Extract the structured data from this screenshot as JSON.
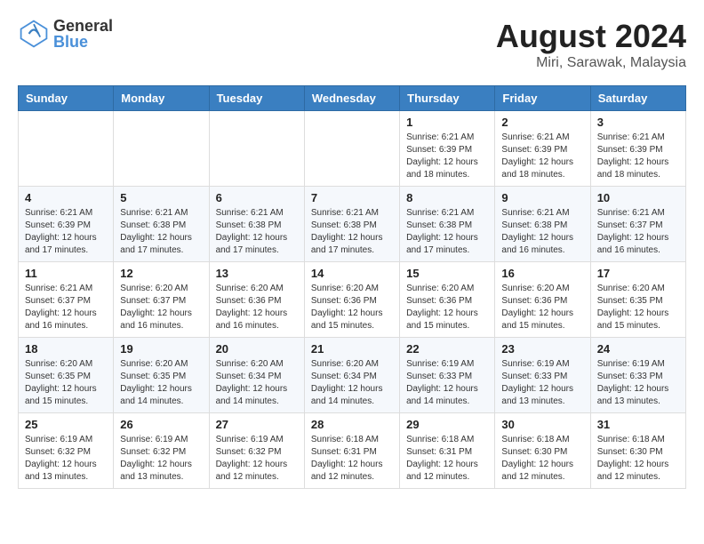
{
  "logo": {
    "line1": "General",
    "line2": "Blue"
  },
  "title": "August 2024",
  "subtitle": "Miri, Sarawak, Malaysia",
  "days_of_week": [
    "Sunday",
    "Monday",
    "Tuesday",
    "Wednesday",
    "Thursday",
    "Friday",
    "Saturday"
  ],
  "weeks": [
    [
      {
        "day": "",
        "info": ""
      },
      {
        "day": "",
        "info": ""
      },
      {
        "day": "",
        "info": ""
      },
      {
        "day": "",
        "info": ""
      },
      {
        "day": "1",
        "info": "Sunrise: 6:21 AM\nSunset: 6:39 PM\nDaylight: 12 hours\nand 18 minutes."
      },
      {
        "day": "2",
        "info": "Sunrise: 6:21 AM\nSunset: 6:39 PM\nDaylight: 12 hours\nand 18 minutes."
      },
      {
        "day": "3",
        "info": "Sunrise: 6:21 AM\nSunset: 6:39 PM\nDaylight: 12 hours\nand 18 minutes."
      }
    ],
    [
      {
        "day": "4",
        "info": "Sunrise: 6:21 AM\nSunset: 6:39 PM\nDaylight: 12 hours\nand 17 minutes."
      },
      {
        "day": "5",
        "info": "Sunrise: 6:21 AM\nSunset: 6:38 PM\nDaylight: 12 hours\nand 17 minutes."
      },
      {
        "day": "6",
        "info": "Sunrise: 6:21 AM\nSunset: 6:38 PM\nDaylight: 12 hours\nand 17 minutes."
      },
      {
        "day": "7",
        "info": "Sunrise: 6:21 AM\nSunset: 6:38 PM\nDaylight: 12 hours\nand 17 minutes."
      },
      {
        "day": "8",
        "info": "Sunrise: 6:21 AM\nSunset: 6:38 PM\nDaylight: 12 hours\nand 17 minutes."
      },
      {
        "day": "9",
        "info": "Sunrise: 6:21 AM\nSunset: 6:38 PM\nDaylight: 12 hours\nand 16 minutes."
      },
      {
        "day": "10",
        "info": "Sunrise: 6:21 AM\nSunset: 6:37 PM\nDaylight: 12 hours\nand 16 minutes."
      }
    ],
    [
      {
        "day": "11",
        "info": "Sunrise: 6:21 AM\nSunset: 6:37 PM\nDaylight: 12 hours\nand 16 minutes."
      },
      {
        "day": "12",
        "info": "Sunrise: 6:20 AM\nSunset: 6:37 PM\nDaylight: 12 hours\nand 16 minutes."
      },
      {
        "day": "13",
        "info": "Sunrise: 6:20 AM\nSunset: 6:36 PM\nDaylight: 12 hours\nand 16 minutes."
      },
      {
        "day": "14",
        "info": "Sunrise: 6:20 AM\nSunset: 6:36 PM\nDaylight: 12 hours\nand 15 minutes."
      },
      {
        "day": "15",
        "info": "Sunrise: 6:20 AM\nSunset: 6:36 PM\nDaylight: 12 hours\nand 15 minutes."
      },
      {
        "day": "16",
        "info": "Sunrise: 6:20 AM\nSunset: 6:36 PM\nDaylight: 12 hours\nand 15 minutes."
      },
      {
        "day": "17",
        "info": "Sunrise: 6:20 AM\nSunset: 6:35 PM\nDaylight: 12 hours\nand 15 minutes."
      }
    ],
    [
      {
        "day": "18",
        "info": "Sunrise: 6:20 AM\nSunset: 6:35 PM\nDaylight: 12 hours\nand 15 minutes."
      },
      {
        "day": "19",
        "info": "Sunrise: 6:20 AM\nSunset: 6:35 PM\nDaylight: 12 hours\nand 14 minutes."
      },
      {
        "day": "20",
        "info": "Sunrise: 6:20 AM\nSunset: 6:34 PM\nDaylight: 12 hours\nand 14 minutes."
      },
      {
        "day": "21",
        "info": "Sunrise: 6:20 AM\nSunset: 6:34 PM\nDaylight: 12 hours\nand 14 minutes."
      },
      {
        "day": "22",
        "info": "Sunrise: 6:19 AM\nSunset: 6:33 PM\nDaylight: 12 hours\nand 14 minutes."
      },
      {
        "day": "23",
        "info": "Sunrise: 6:19 AM\nSunset: 6:33 PM\nDaylight: 12 hours\nand 13 minutes."
      },
      {
        "day": "24",
        "info": "Sunrise: 6:19 AM\nSunset: 6:33 PM\nDaylight: 12 hours\nand 13 minutes."
      }
    ],
    [
      {
        "day": "25",
        "info": "Sunrise: 6:19 AM\nSunset: 6:32 PM\nDaylight: 12 hours\nand 13 minutes."
      },
      {
        "day": "26",
        "info": "Sunrise: 6:19 AM\nSunset: 6:32 PM\nDaylight: 12 hours\nand 13 minutes."
      },
      {
        "day": "27",
        "info": "Sunrise: 6:19 AM\nSunset: 6:32 PM\nDaylight: 12 hours\nand 12 minutes."
      },
      {
        "day": "28",
        "info": "Sunrise: 6:18 AM\nSunset: 6:31 PM\nDaylight: 12 hours\nand 12 minutes."
      },
      {
        "day": "29",
        "info": "Sunrise: 6:18 AM\nSunset: 6:31 PM\nDaylight: 12 hours\nand 12 minutes."
      },
      {
        "day": "30",
        "info": "Sunrise: 6:18 AM\nSunset: 6:30 PM\nDaylight: 12 hours\nand 12 minutes."
      },
      {
        "day": "31",
        "info": "Sunrise: 6:18 AM\nSunset: 6:30 PM\nDaylight: 12 hours\nand 12 minutes."
      }
    ]
  ]
}
